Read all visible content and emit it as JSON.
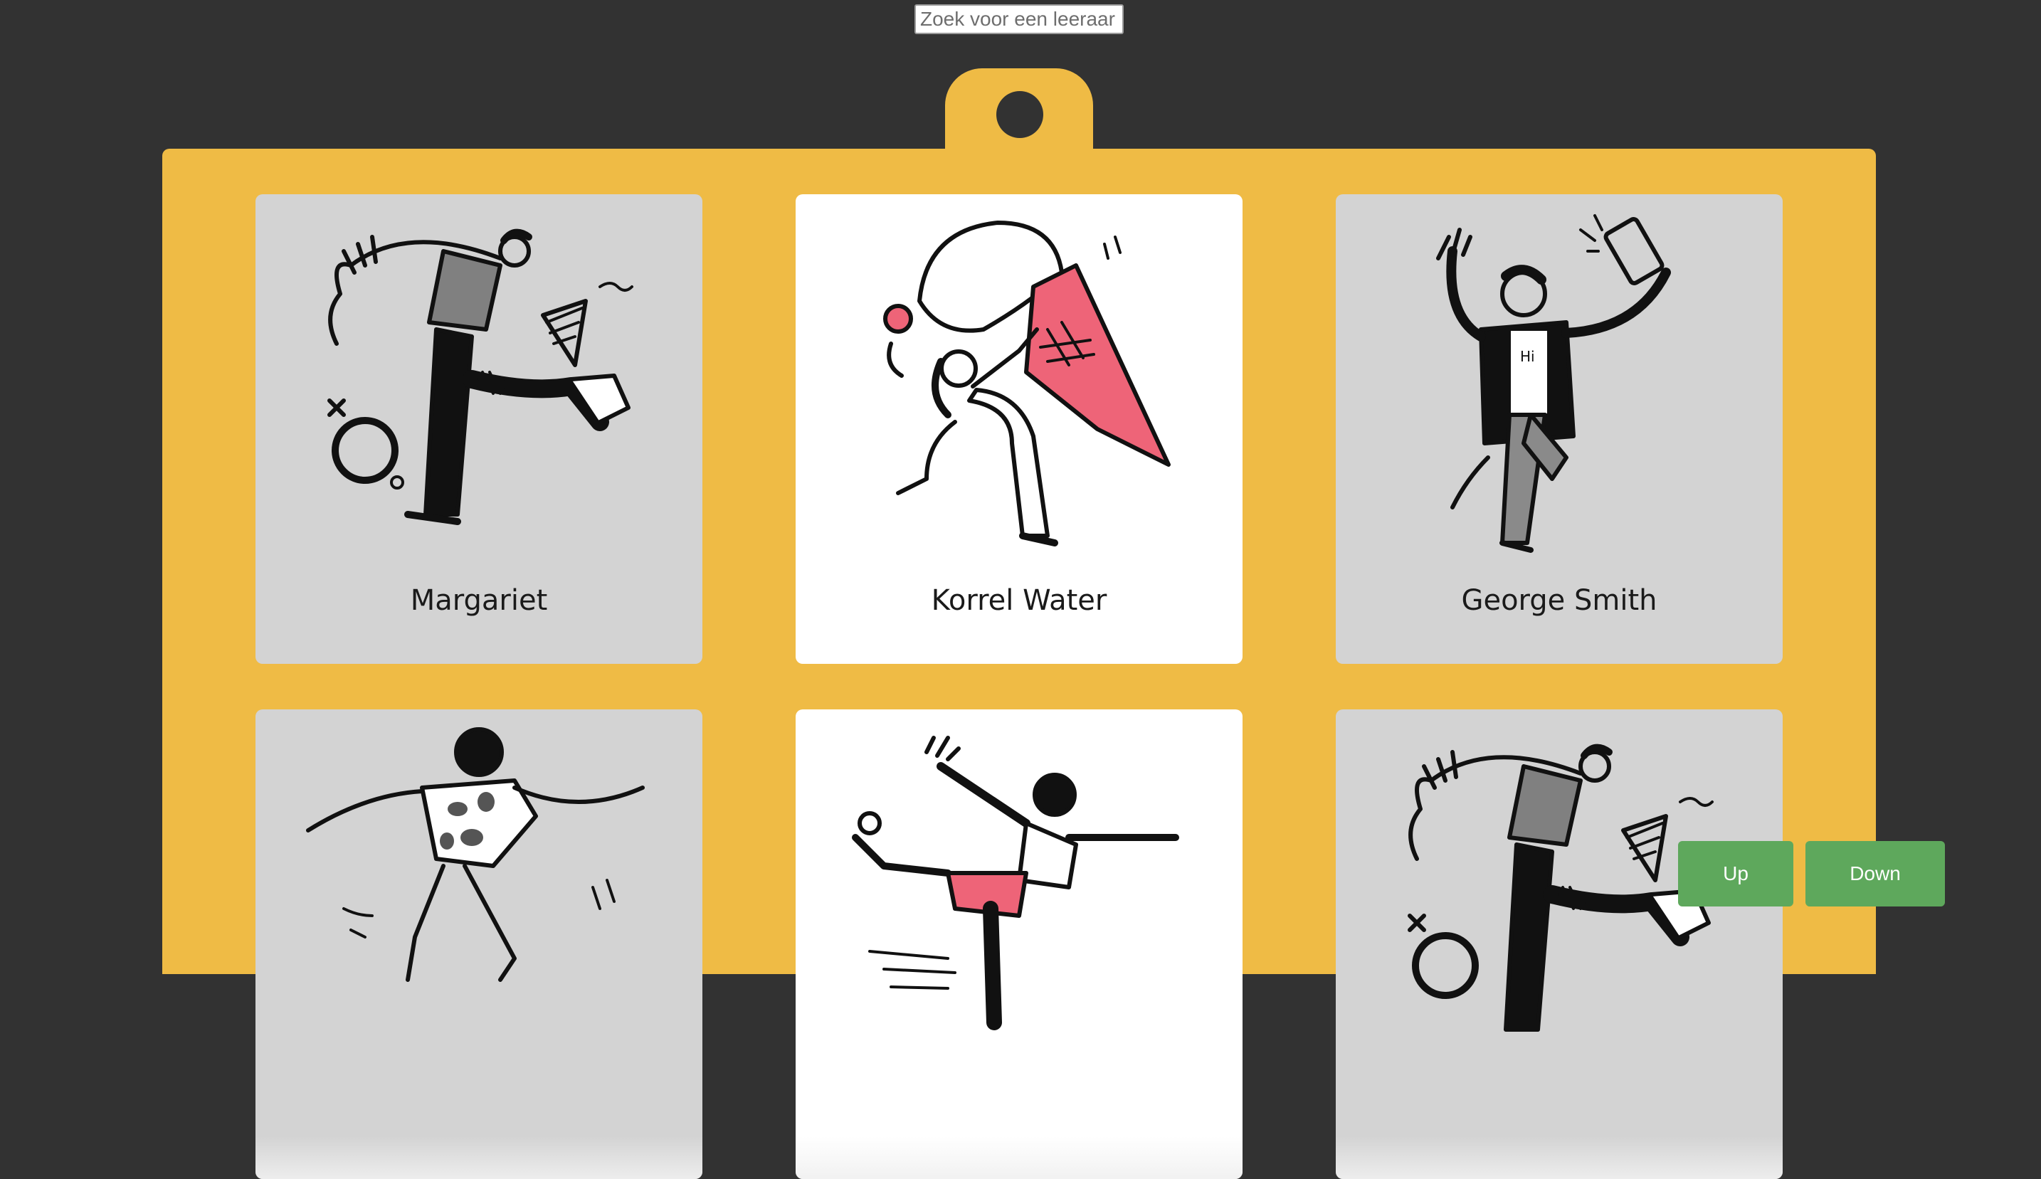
{
  "search": {
    "placeholder": "Zoek voor een leeraar"
  },
  "teachers": [
    {
      "name": "Margariet",
      "illustration": "dancing-person-icon",
      "card_color": "#d3d3d3"
    },
    {
      "name": "Korrel Water",
      "illustration": "person-carrying-ice-cream-icon",
      "card_color": "#ffffff"
    },
    {
      "name": "George Smith",
      "illustration": "person-taking-selfie-icon",
      "card_color": "#d3d3d3"
    },
    {
      "name": "",
      "illustration": "person-dancing-icon",
      "card_color": "#d3d3d3"
    },
    {
      "name": "",
      "illustration": "person-skating-icon",
      "card_color": "#ffffff"
    },
    {
      "name": "",
      "illustration": "dancing-person-icon",
      "card_color": "#d3d3d3"
    }
  ],
  "controls": {
    "up_label": "Up",
    "down_label": "Down"
  },
  "colors": {
    "background": "#323232",
    "board": "#efbb45",
    "button": "#5ea85c",
    "ice_cream": "#ee6478"
  }
}
